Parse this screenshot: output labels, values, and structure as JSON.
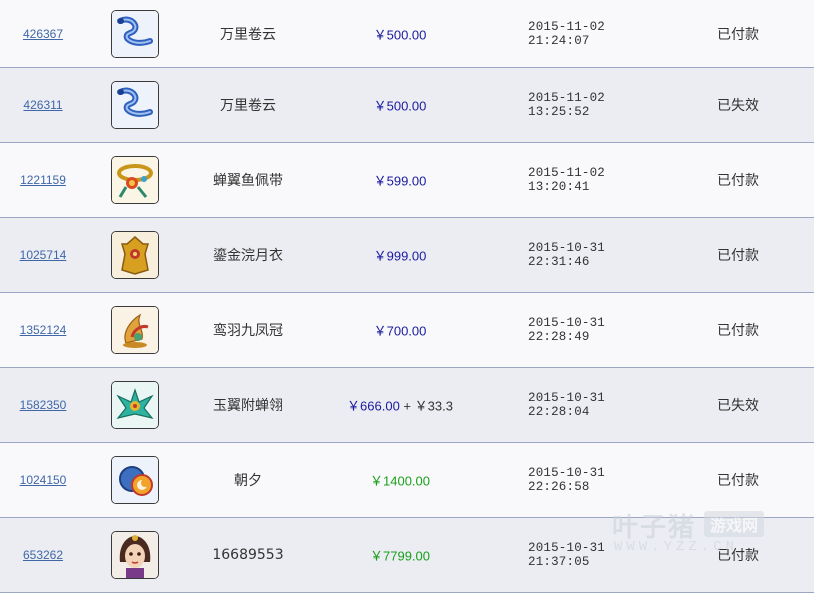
{
  "orders": [
    {
      "id": "426367",
      "icon": "blue-ribbon-icon",
      "name": "万里卷云",
      "price": "￥500.00",
      "price_color": "#1a1aa0",
      "extra": "",
      "time": "2015-11-02 21:24:07",
      "status": "已付款"
    },
    {
      "id": "426311",
      "icon": "blue-ribbon-icon",
      "name": "万里卷云",
      "price": "￥500.00",
      "price_color": "#1a1aa0",
      "extra": "",
      "time": "2015-11-02 13:25:52",
      "status": "已失效"
    },
    {
      "id": "1221159",
      "icon": "golden-belt-icon",
      "name": "蝉翼鱼佩带",
      "price": "￥599.00",
      "price_color": "#1a1aa0",
      "extra": "",
      "time": "2015-11-02 13:20:41",
      "status": "已付款"
    },
    {
      "id": "1025714",
      "icon": "golden-armor-icon",
      "name": "鎏金浣月衣",
      "price": "￥999.00",
      "price_color": "#1a1aa0",
      "extra": "",
      "time": "2015-10-31 22:31:46",
      "status": "已付款"
    },
    {
      "id": "1352124",
      "icon": "phoenix-crown-icon",
      "name": "鸾羽九凤冠",
      "price": "￥700.00",
      "price_color": "#1a1aa0",
      "extra": "",
      "time": "2015-10-31 22:28:49",
      "status": "已付款"
    },
    {
      "id": "1582350",
      "icon": "jade-wing-crown-icon",
      "name": "玉翼附蝉翎",
      "price": "￥666.00",
      "price_color": "#1a1aa0",
      "extra": "￥33.3",
      "time": "2015-10-31 22:28:04",
      "status": "已失效"
    },
    {
      "id": "1024150",
      "icon": "sun-moon-emblem-icon",
      "name": "朝夕",
      "price": "￥1400.00",
      "price_color": "#1aa01a",
      "extra": "",
      "time": "2015-10-31 22:26:58",
      "status": "已付款"
    },
    {
      "id": "653262",
      "icon": "character-portrait-icon",
      "name": "16689553",
      "price": "￥7799.00",
      "price_color": "#1aa01a",
      "extra": "",
      "time": "2015-10-31 21:37:05",
      "status": "已付款"
    }
  ],
  "plus_sign": "+",
  "watermark": {
    "main": "叶子猪",
    "badge": "游戏网",
    "sub": "WWW.YZZ.CN"
  }
}
